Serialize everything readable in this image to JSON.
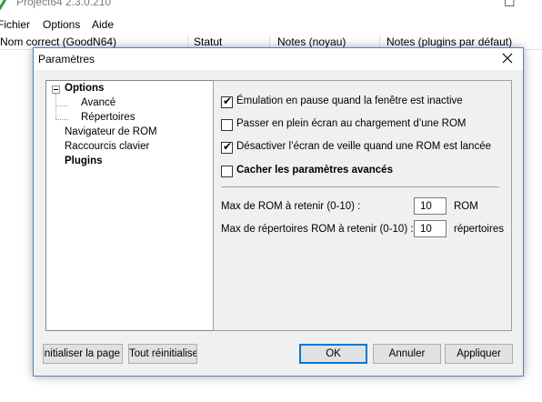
{
  "app": {
    "title": "Project64 2.3.0.210",
    "maximize_glyph": "☐",
    "menu": [
      "Fichier",
      "Options",
      "Aide"
    ],
    "columns": [
      "Nom correct (GoodN64)",
      "Statut",
      "Notes (noyau)",
      "Notes (plugins par défaut)"
    ]
  },
  "dialog": {
    "title": "Paramètres",
    "tree": [
      {
        "label": "Options",
        "bold": true,
        "expander": "minus"
      },
      {
        "label": "Avancé",
        "bold": false
      },
      {
        "label": "Répertoires",
        "bold": false
      },
      {
        "label": "Navigateur de ROM",
        "bold": false
      },
      {
        "label": "Raccourcis clavier",
        "bold": false
      },
      {
        "label": "Plugins",
        "bold": true
      }
    ],
    "checkboxes": [
      {
        "label": "Émulation en pause quand la fenêtre est inactive",
        "checked": true
      },
      {
        "label": "Passer en plein écran au chargement d’une ROM",
        "checked": false
      },
      {
        "label": "Désactiver l’écran de veille quand une ROM est lancée",
        "checked": true
      },
      {
        "label": "Cacher les paramètres avancés",
        "checked": false,
        "bold": true
      }
    ],
    "check_glyph": "✔",
    "max_rom": {
      "label": "Max de ROM à retenir (0-10) :",
      "value": "10",
      "unit": "ROM"
    },
    "max_dirs": {
      "label": "Max de répertoires ROM à retenir (0-10) :",
      "value": "10",
      "unit": "répertoires"
    },
    "buttons": {
      "reset_page": "Réinitialiser la page",
      "reset_all": "Tout réinitialiser",
      "ok": "OK",
      "cancel": "Annuler",
      "apply": "Appliquer"
    }
  },
  "colors": {
    "dialog_border": "#5a82b8",
    "focus_border": "#0078d7",
    "dialog_bg": "#f0f0f0"
  },
  "icons": [
    "project64-app-icon",
    "maximize-icon",
    "close-icon",
    "tree-collapse-icon",
    "checkmark-icon"
  ]
}
